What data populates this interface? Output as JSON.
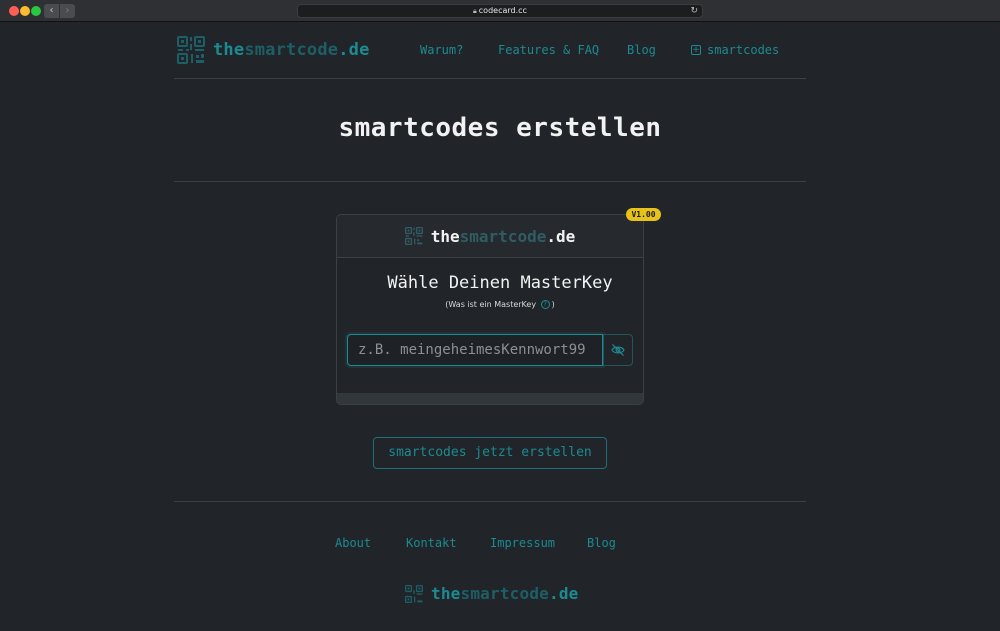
{
  "browser": {
    "url": "codecard.cc",
    "back": "‹",
    "forward": "›"
  },
  "header": {
    "logo_prefix": "the",
    "logo_mid": "smartcode",
    "logo_suffix": ".de",
    "nav": {
      "warum": "Warum?",
      "features": "Features & FAQ",
      "blog": "Blog",
      "smartcodes": "smartcodes"
    }
  },
  "page_title": "smartcodes erstellen",
  "card": {
    "badge": "V1.00",
    "logo_prefix": "the",
    "logo_mid": "smartcode",
    "logo_suffix": ".de",
    "title": "Wähle Deinen MasterKey",
    "subtitle_open": "(Was ist ein MasterKey",
    "subtitle_close": ")",
    "help_glyph": "?",
    "input_placeholder": "z.B. meingeheimesKennwort99",
    "input_value": ""
  },
  "cta_label": "smartcodes jetzt erstellen",
  "footer": {
    "links": {
      "about": "About",
      "kontakt": "Kontakt",
      "impressum": "Impressum",
      "blog": "Blog"
    },
    "logo_prefix": "the",
    "logo_mid": "smartcode",
    "logo_suffix": ".de"
  },
  "colors": {
    "background": "#212529",
    "accent": "#1c8a92",
    "badge": "#e6c21b"
  },
  "icons": {
    "logo": "qr-code-icon",
    "smartcodes": "plus-square-icon",
    "password_toggle": "eye-slash-icon",
    "help": "question-circle-icon"
  }
}
